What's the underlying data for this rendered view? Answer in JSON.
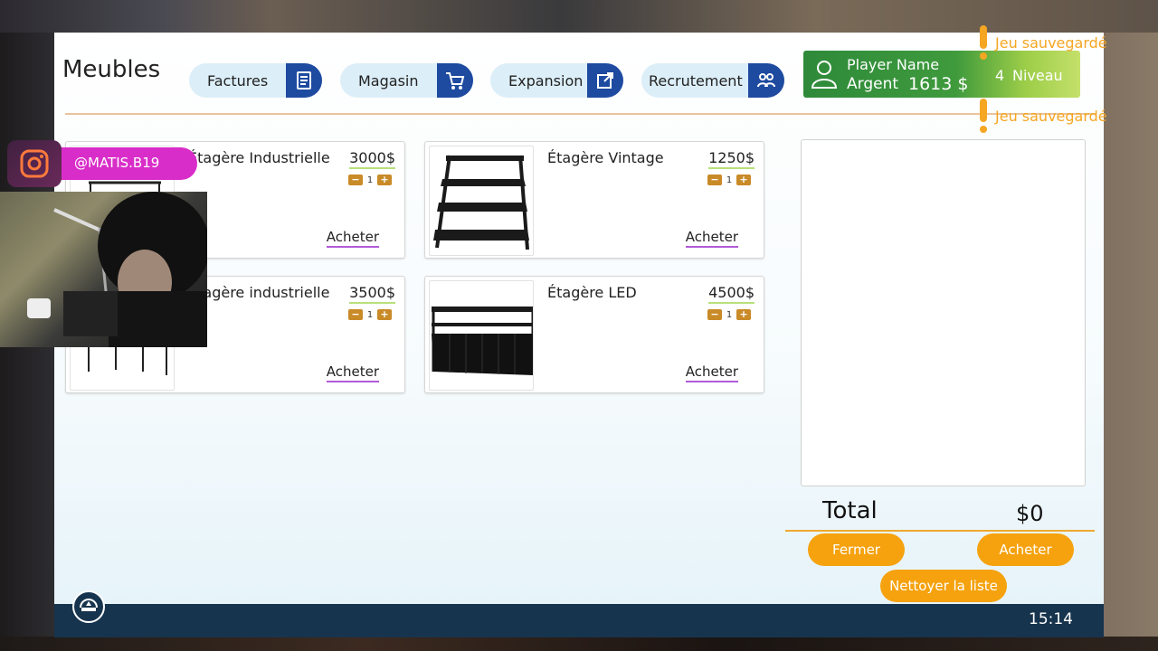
{
  "window": {
    "title": "Meubles"
  },
  "tabs": [
    {
      "label": "Factures",
      "icon": "invoice-icon"
    },
    {
      "label": "Magasin",
      "icon": "cart-icon"
    },
    {
      "label": "Expansion",
      "icon": "external-link-icon"
    },
    {
      "label": "Recrutement",
      "icon": "people-icon"
    }
  ],
  "player": {
    "name": "Player Name",
    "money_label": "Argent",
    "money": "1613 $",
    "level": "4",
    "level_label": "Niveau"
  },
  "notifications": [
    "Jeu sauvegardé",
    "Jeu sauvegardé"
  ],
  "products": [
    {
      "name": "Étagère Industrielle",
      "price": "3000$",
      "qty": "1",
      "buy_label": "Acheter"
    },
    {
      "name": "Étagère Vintage",
      "price": "1250$",
      "qty": "1",
      "buy_label": "Acheter"
    },
    {
      "name": "Étagère industrielle",
      "price": "3500$",
      "qty": "1",
      "buy_label": "Acheter"
    },
    {
      "name": "Étagère LED",
      "price": "4500$",
      "qty": "1",
      "buy_label": "Acheter"
    }
  ],
  "cart": {
    "total_label": "Total",
    "total_value": "$0",
    "close_label": "Fermer",
    "buy_label": "Acheter",
    "clear_label": "Nettoyer la liste"
  },
  "statusbar": {
    "time": "15:14"
  },
  "overlay": {
    "handle": "@MATIS.B19"
  },
  "colors": {
    "accent": "#f5a20e",
    "tab_icon": "#1e4aa0",
    "player_bg": "#2e8a3a",
    "statusbar": "#17344e",
    "notification": "#f5a623"
  }
}
